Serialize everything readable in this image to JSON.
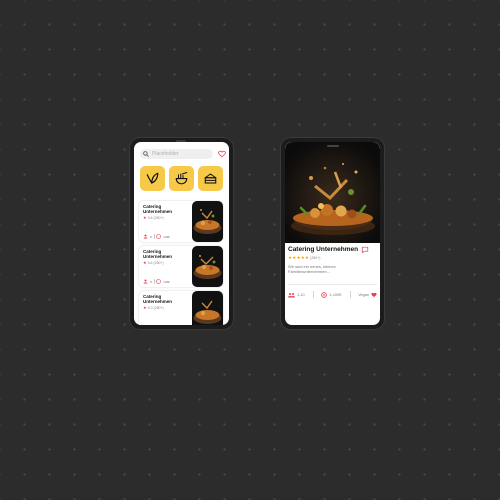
{
  "colors": {
    "background": "#2c2c2c",
    "accent_yellow": "#f7c948",
    "accent_pink": "#e53950",
    "star_gold": "#f2a900"
  },
  "list_screen": {
    "search": {
      "placeholder": "Placeholder",
      "icon": "search-icon"
    },
    "favorites_icon": "heart-icon",
    "categories": [
      {
        "icon": "leaf-icon"
      },
      {
        "icon": "noodle-bowl-icon"
      },
      {
        "icon": "cake-icon"
      }
    ],
    "cards": [
      {
        "title": "Catering Unternehmen",
        "rating": "3.6",
        "reviews": "(250+)",
        "stat1": "8",
        "stat2": "12€€"
      },
      {
        "title": "Catering Unternehmen",
        "rating": "3.6",
        "reviews": "(250+)",
        "stat1": "8",
        "stat2": "12€€"
      },
      {
        "title": "Catering Unternehmen",
        "rating": "4.0",
        "reviews": "(250+)"
      }
    ]
  },
  "detail_screen": {
    "title": "Catering Unternehmen",
    "rating": 4.5,
    "stars": "★★★★★",
    "reviews": "(250+)",
    "description": "Wir sind ein neues, kleines Familienunternehmen...",
    "stats": {
      "people": "1-10",
      "price": "1-100€",
      "diet": "Vegan"
    }
  }
}
